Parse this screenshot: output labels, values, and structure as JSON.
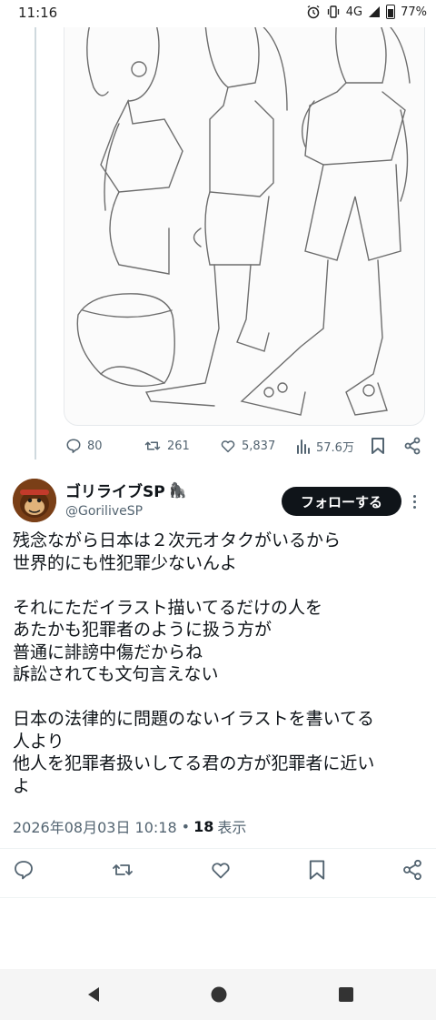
{
  "status_bar": {
    "time": "11:16",
    "network": "4G",
    "battery": "77%"
  },
  "parent_tweet": {
    "actions": {
      "replies": "80",
      "retweets": "261",
      "likes": "5,837",
      "views": "57.6万"
    }
  },
  "tweet": {
    "display_name": "ゴリライブSP",
    "name_emoji": "🦍",
    "handle": "@GoriliveSP",
    "follow_label": "フォローする",
    "lines": [
      "残念ながら日本は２次元オタクがいるから",
      "世界的にも性犯罪少ないんよ",
      "",
      "それにただイラスト描いてるだけの人を",
      "あたかも犯罪者のように扱う方が",
      "普通に誹謗中傷だからね",
      "訴訟されても文句言えない",
      "",
      "日本の法律的に問題のないイラストを書いてる",
      "人より",
      "他人を犯罪者扱いしてる君の方が犯罪者に近い",
      "よ"
    ],
    "timestamp": "2026年08月03日 10:18",
    "separator": "•",
    "views_count": "18",
    "views_label": "表示"
  },
  "icons": {
    "status": [
      "alarm-icon",
      "vibrate-icon",
      "signal-icon",
      "battery-icon"
    ],
    "actions": [
      "reply-icon",
      "retweet-icon",
      "like-icon",
      "views-icon",
      "bookmark-icon",
      "share-icon"
    ],
    "nav": [
      "back-icon",
      "home-icon",
      "recents-icon"
    ]
  },
  "colors": {
    "text": "#0f1419",
    "secondary": "#536471",
    "divider": "#eff3f4",
    "follow_bg": "#0f1419"
  }
}
